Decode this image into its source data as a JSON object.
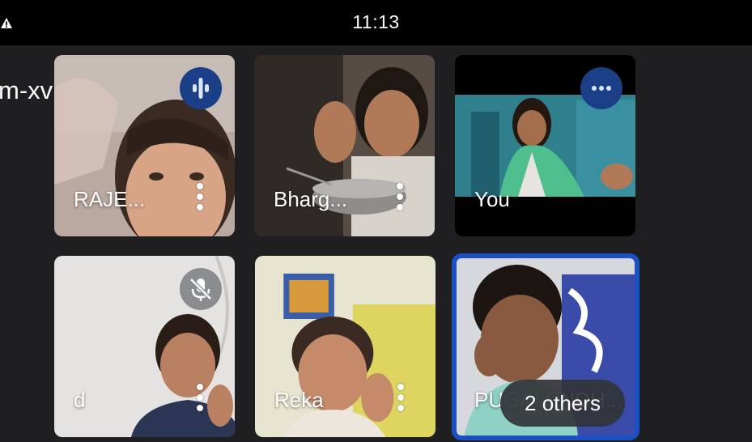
{
  "status_bar": {
    "time": "11:13",
    "alert_icon": "warning-icon"
  },
  "meeting": {
    "code_fragment": "m-xvh",
    "chevron_icon": "chevron-right-icon"
  },
  "participants": [
    {
      "name": "RAJE...",
      "state": "speaking"
    },
    {
      "name": "Bharg...",
      "state": "video"
    },
    {
      "name": "You",
      "state": "speaking"
    },
    {
      "name": "d",
      "state": "muted"
    },
    {
      "name": "Reka",
      "state": "video"
    },
    {
      "name": "PUGALENDH...",
      "state": "pinned"
    }
  ],
  "others_chip": {
    "label": "2 others"
  },
  "colors": {
    "speaking_badge": "#1a3f87",
    "muted_badge": "#8a8c8f",
    "highlight_border": "#1b50c4",
    "background": "#1f1f21"
  }
}
